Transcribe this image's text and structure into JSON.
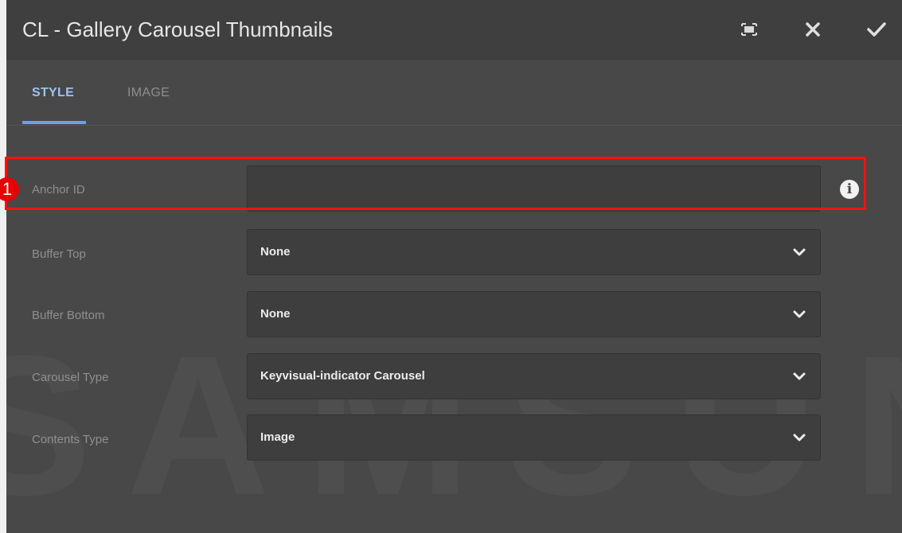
{
  "dialog": {
    "title": "CL - Gallery Carousel Thumbnails",
    "buttons": {
      "fullscreen_icon": "fullscreen-icon",
      "close_icon": "close-icon",
      "done_icon": "checkmark-icon"
    }
  },
  "tabs": [
    {
      "label": "STYLE",
      "active": true
    },
    {
      "label": "IMAGE",
      "active": false
    }
  ],
  "fields": {
    "anchor_id": {
      "label": "Anchor ID",
      "value": ""
    },
    "buffer_top": {
      "label": "Buffer Top",
      "value": "None"
    },
    "buffer_bottom": {
      "label": "Buffer Bottom",
      "value": "None"
    },
    "carousel_type": {
      "label": "Carousel Type",
      "value": "Keyvisual-indicator Carousel"
    },
    "contents_type": {
      "label": "Contents Type",
      "value": "Image"
    }
  },
  "annotation": {
    "badge_number": "1",
    "highlight_color": "#ff1010"
  },
  "info_icon": {
    "glyph": "i",
    "icon": "info-icon"
  },
  "watermark": "SAMSUNG",
  "colors": {
    "accent": "#6d9ee8",
    "active_tab_text": "#9ec1f2",
    "background": "#484848",
    "header": "#3f3f3f",
    "field_bg": "#3e3e3e"
  }
}
